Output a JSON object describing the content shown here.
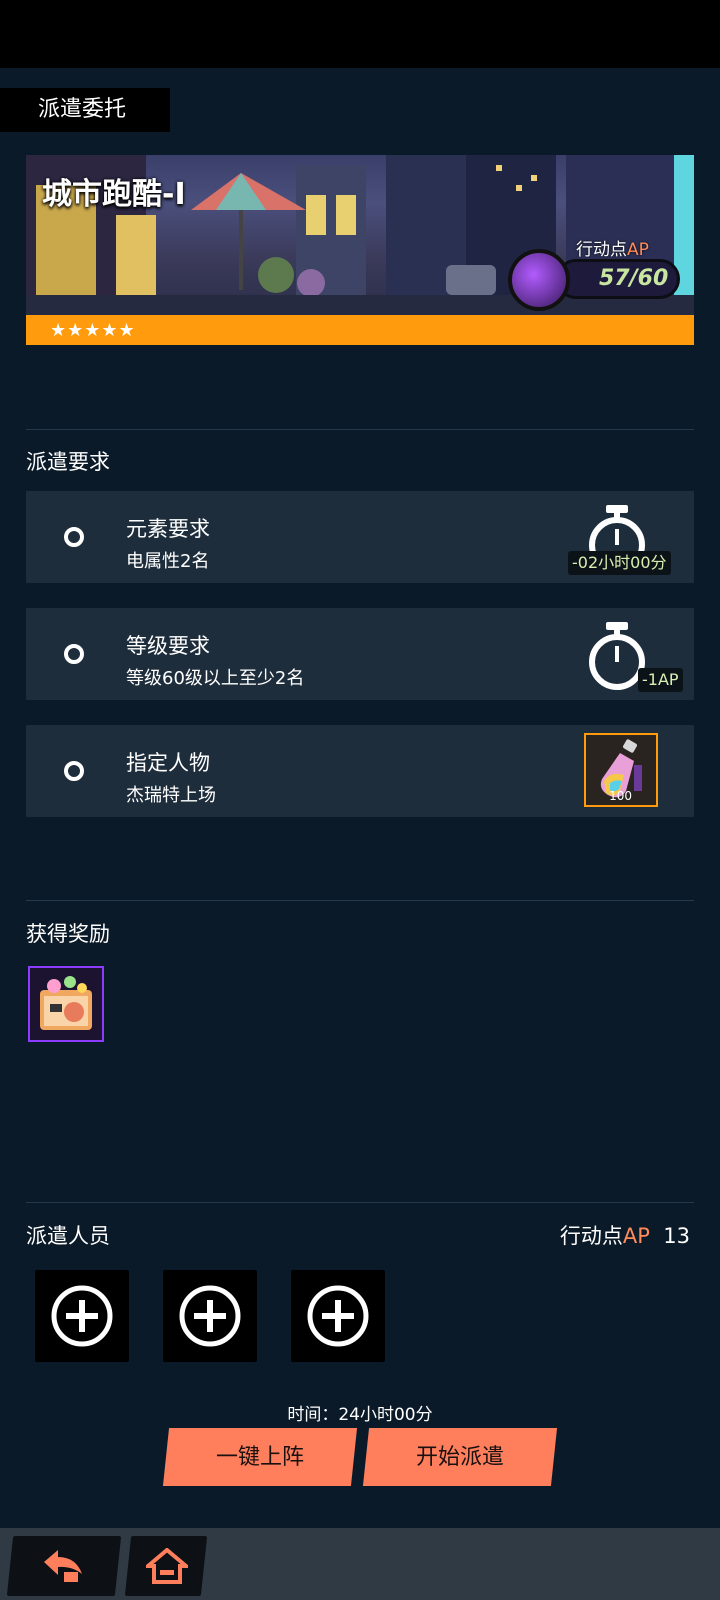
{
  "page": {
    "title": "派遣委托"
  },
  "banner": {
    "title": "城市跑酷-I",
    "stars": "★★★★★",
    "ap_label_prefix": "行动点",
    "ap_label_accent": "AP",
    "ap_value": "57/60"
  },
  "requirements": {
    "heading": "派遣要求",
    "items": [
      {
        "title": "元素要求",
        "subtitle": "电属性2名",
        "tag": "-02小时00分",
        "icon": "stopwatch-icon"
      },
      {
        "title": "等级要求",
        "subtitle": "等级60级以上至少2名",
        "tag": "-1AP",
        "icon": "stopwatch-icon"
      },
      {
        "title": "指定人物",
        "subtitle": "杰瑞特上场",
        "tag": "100",
        "icon": "potion-icon"
      }
    ]
  },
  "rewards": {
    "heading": "获得奖励",
    "items": [
      {
        "icon": "gift-box-icon"
      }
    ]
  },
  "dispatch": {
    "heading": "派遣人员",
    "ap_prefix": "行动点",
    "ap_accent": "AP",
    "ap_value": "13",
    "slots": 3,
    "time_text": "时间：24小时00分",
    "auto_button": "一键上阵",
    "start_button": "开始派遣"
  },
  "nav": {
    "back_icon": "back-arrow-icon",
    "home_icon": "home-icon"
  },
  "colors": {
    "accent_orange": "#ff9b0d",
    "button_coral": "#ff7f5c",
    "ap_accent": "#ff8a5a",
    "reward_border": "#8a3cff"
  }
}
